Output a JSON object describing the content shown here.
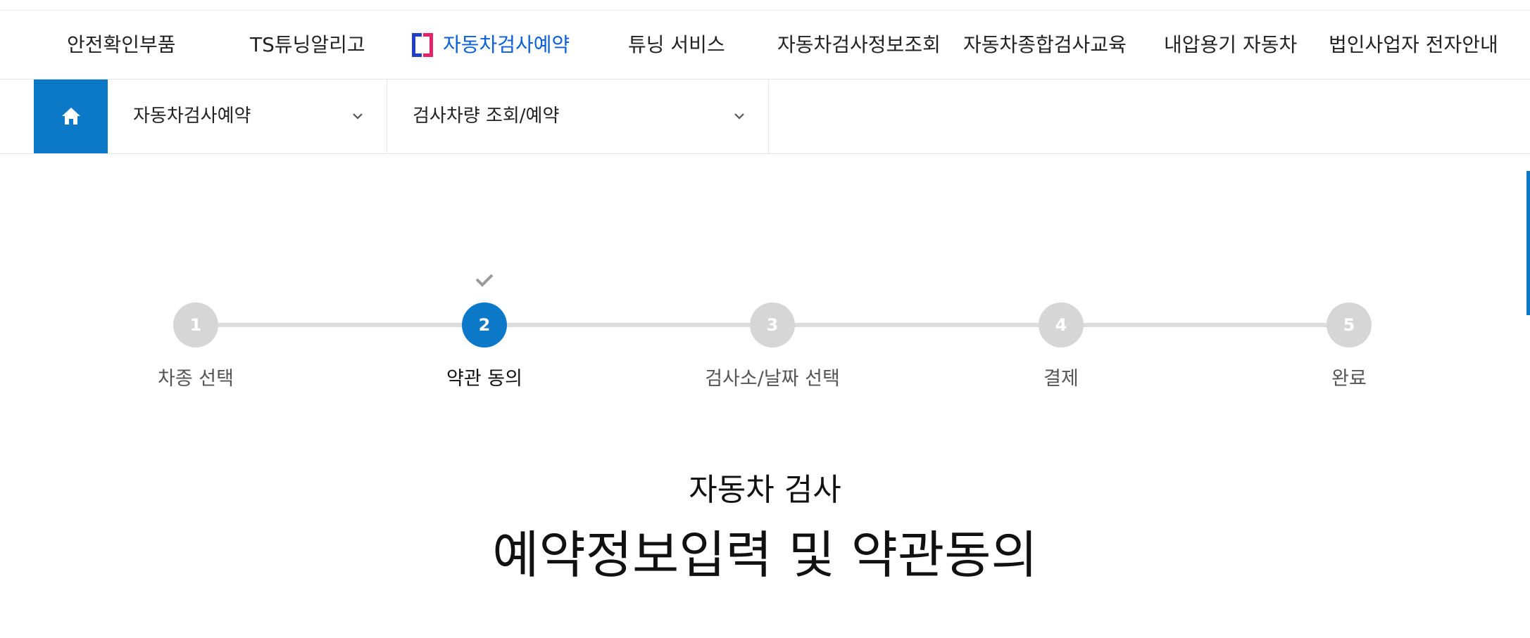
{
  "gnb": {
    "items": [
      {
        "label": "안전확인부품",
        "active": false
      },
      {
        "label": "TS튜닝알리고",
        "active": false
      },
      {
        "label": "자동차검사예약",
        "active": true
      },
      {
        "label": "튜닝 서비스",
        "active": false
      },
      {
        "label": "자동차검사정보조회",
        "active": false
      },
      {
        "label": "자동차종합검사교육",
        "active": false
      },
      {
        "label": "내압용기 자동차",
        "active": false
      },
      {
        "label": "법인사업자 전자안내",
        "active": false
      }
    ]
  },
  "location": {
    "home_icon": "home-icon",
    "depth1": "자동차검사예약",
    "depth2": "검사차량 조회/예약"
  },
  "steps": {
    "current": 2,
    "items": [
      {
        "num": "1",
        "label": "차종 선택"
      },
      {
        "num": "2",
        "label": "약관 동의"
      },
      {
        "num": "3",
        "label": "검사소/날짜 선택"
      },
      {
        "num": "4",
        "label": "결제"
      },
      {
        "num": "5",
        "label": "완료"
      }
    ]
  },
  "page": {
    "subtitle": "자동차 검사",
    "title": "예약정보입력 및 약관동의"
  },
  "colors": {
    "primary": "#0b78c8",
    "active_menu": "#0b5fd8",
    "step_inactive": "#d6d6d6"
  }
}
